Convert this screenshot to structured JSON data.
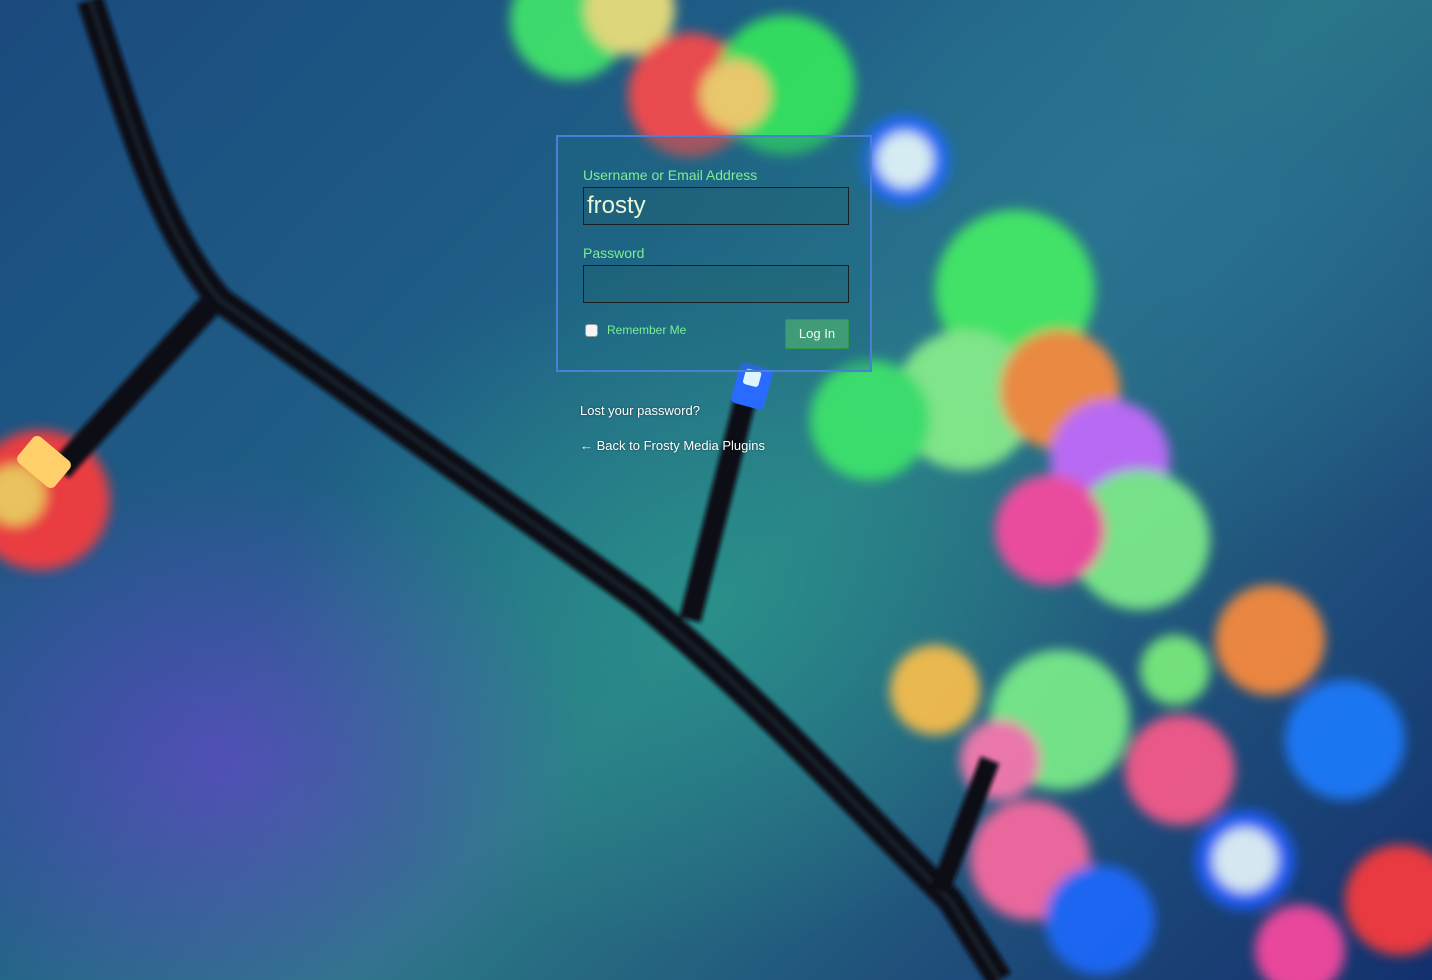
{
  "login_form": {
    "username_label": "Username or Email Address",
    "username_value": "frosty",
    "password_label": "Password",
    "password_value": "",
    "remember_label": "Remember Me",
    "remember_checked": false,
    "login_button_label": "Log In"
  },
  "links": {
    "lost_password": "Lost your password?",
    "back_arrow": "←",
    "back_to_site": "Back to Frosty Media Plugins"
  },
  "colors": {
    "label_green": "#7bf08f",
    "box_border_blue": "#4a7fd8",
    "button_green": "#5abe6e"
  }
}
